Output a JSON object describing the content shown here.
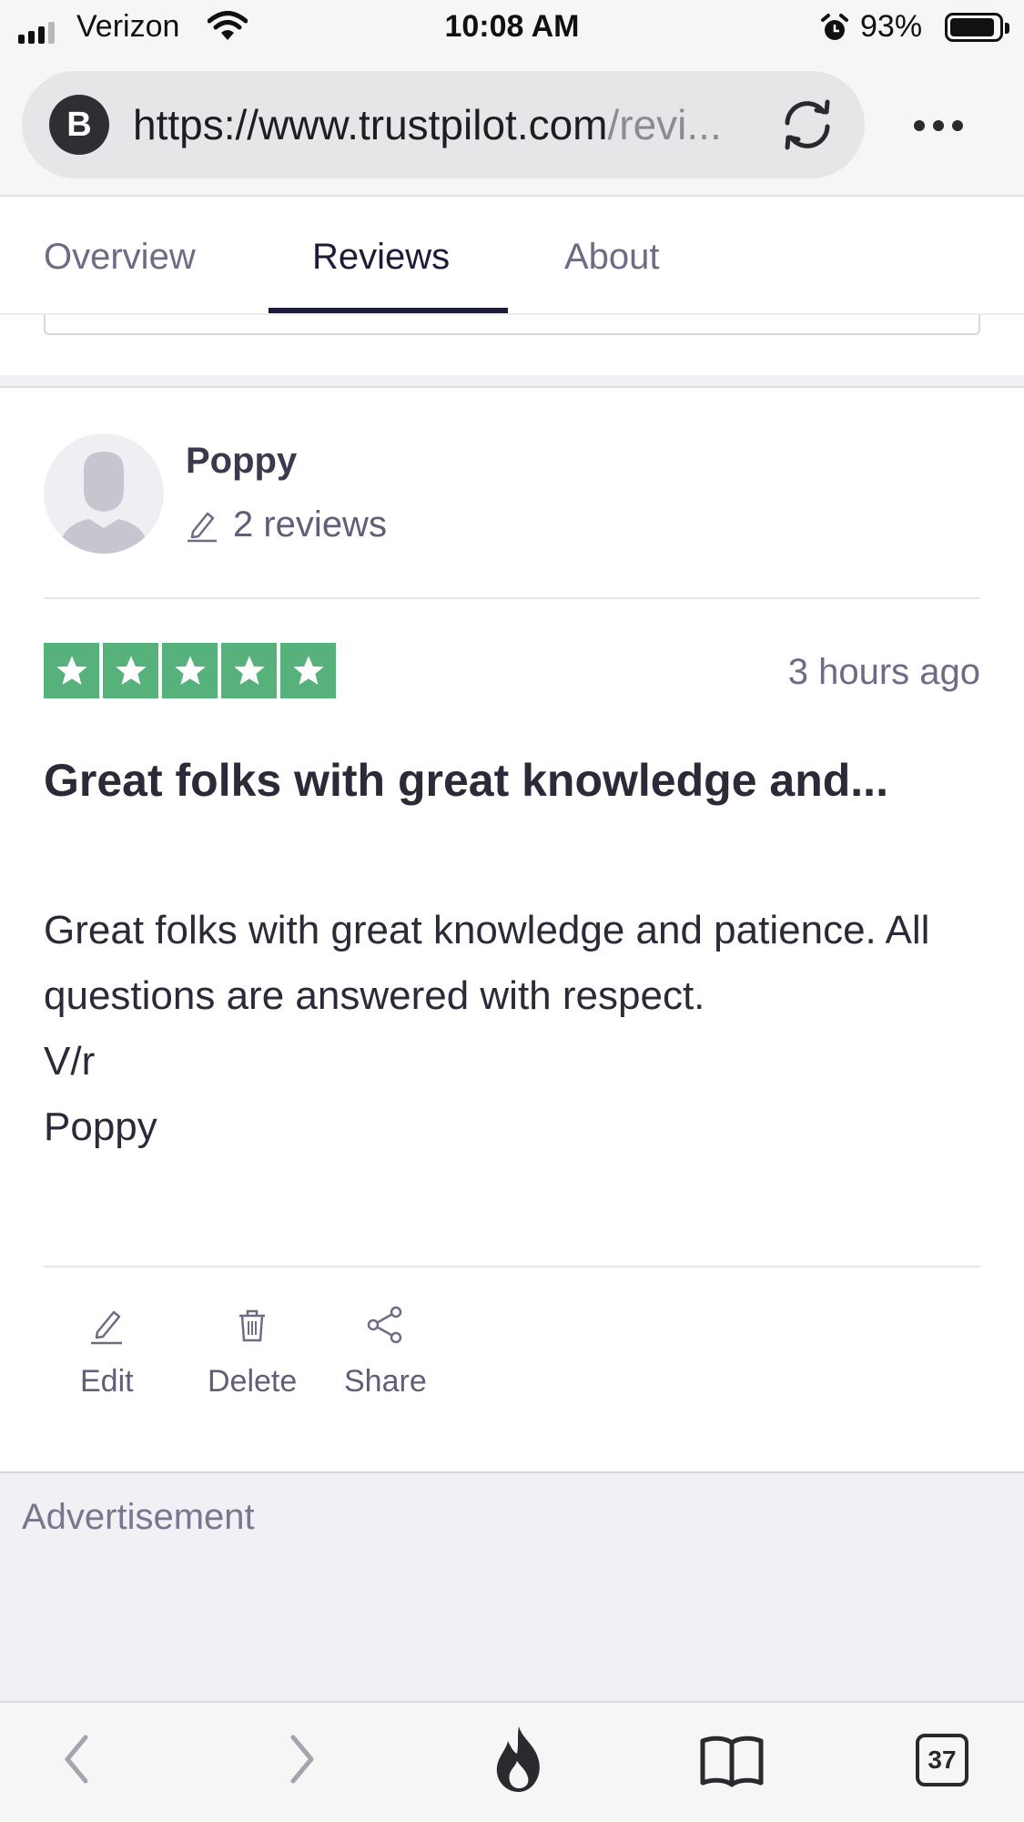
{
  "status_bar": {
    "carrier": "Verizon",
    "time": "10:08 AM",
    "battery_percent": "93%",
    "icons": [
      "signal-icon",
      "wifi-icon",
      "alarm-icon",
      "battery-icon"
    ]
  },
  "browser": {
    "site_badge": "B",
    "url_host": "https://www.trustpilot.com",
    "url_path": "/revi...",
    "icons": [
      "reload-icon",
      "more-icon"
    ]
  },
  "tabs": [
    {
      "label": "Overview",
      "active": false
    },
    {
      "label": "Reviews",
      "active": true
    },
    {
      "label": "About",
      "active": false
    }
  ],
  "review": {
    "reviewer_name": "Poppy",
    "review_count": "2 reviews",
    "rating": 5,
    "max_rating": 5,
    "date": "3 hours ago",
    "title": "Great folks with great knowledge and...",
    "body": {
      "line1": "Great folks with great knowledge and patience. All questions are answered with respect.",
      "line2": "V/r",
      "line3": "Poppy"
    },
    "star_color": "#56b27a",
    "actions": {
      "edit": "Edit",
      "delete": "Delete",
      "share": "Share"
    }
  },
  "advertisement": {
    "label": "Advertisement"
  },
  "toolbar": {
    "tab_count": "37",
    "icons": [
      "back-icon",
      "forward-icon",
      "flame-icon",
      "bookmarks-icon",
      "tabs-icon"
    ]
  }
}
